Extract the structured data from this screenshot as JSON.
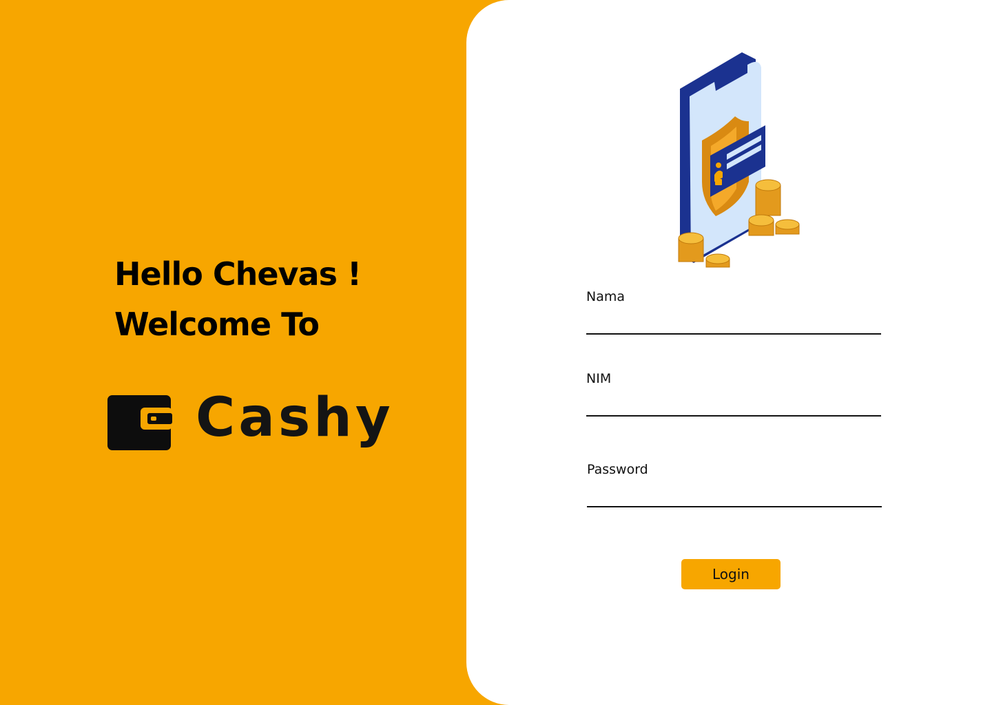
{
  "greeting": {
    "line1": "Hello Chevas !",
    "line2": "Welcome To"
  },
  "brand": {
    "name": "Cashy",
    "icon": "wallet-icon"
  },
  "illustration": {
    "icon": "secure-phone-payment-illustration"
  },
  "form": {
    "nama_label": "Nama",
    "nama_value": "",
    "nim_label": "NIM",
    "nim_value": "",
    "password_label": "Password",
    "password_value": "",
    "login_label": "Login"
  },
  "colors": {
    "accent": "#F7A600",
    "panel": "#FFFFFF",
    "text": "#111111",
    "illustration_blue": "#1B3290",
    "illustration_light_blue": "#D3E6FB"
  }
}
